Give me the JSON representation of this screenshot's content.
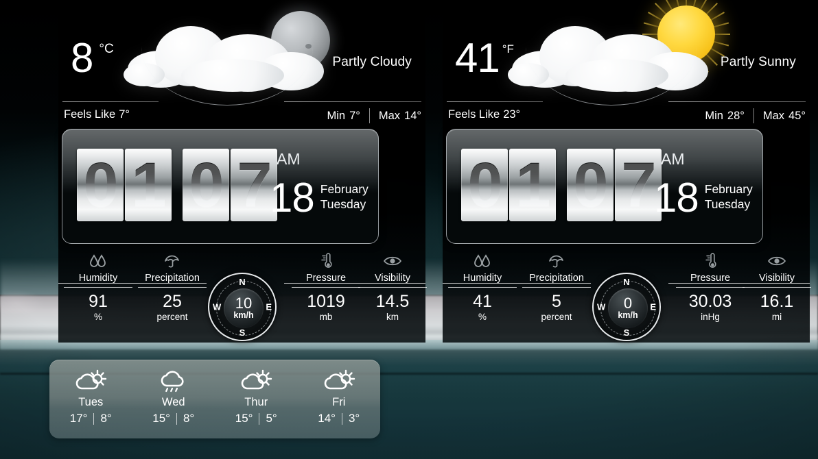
{
  "panels": [
    {
      "id": "left",
      "temperature": "8",
      "unit": "°C",
      "condition": "Partly Cloudy",
      "icon": "moon-cloud-icon",
      "feels_like_label": "Feels Like",
      "feels_like_value": "7°",
      "min_label": "Min",
      "min_value": "7°",
      "max_label": "Max",
      "max_value": "14°",
      "clock": {
        "hour_digits": [
          "0",
          "1"
        ],
        "minute_digits": [
          "0",
          "7"
        ],
        "meridiem": "AM",
        "day_number": "18",
        "month": "February",
        "weekday": "Tuesday"
      },
      "stats": {
        "humidity": {
          "label": "Humidity",
          "value": "91",
          "unit": "%",
          "icon": "droplets-icon"
        },
        "precipitation": {
          "label": "Precipitation",
          "value": "25",
          "unit": "percent",
          "icon": "umbrella-icon"
        },
        "pressure": {
          "label": "Pressure",
          "value": "1019",
          "unit": "mb",
          "icon": "thermometer-icon"
        },
        "visibility": {
          "label": "Visibility",
          "value": "14.5",
          "unit": "km",
          "icon": "eye-icon"
        }
      },
      "wind": {
        "value": "10",
        "unit": "km/h",
        "north": "N",
        "east": "E",
        "south": "S",
        "west": "W"
      }
    },
    {
      "id": "right",
      "temperature": "41",
      "unit": "°F",
      "condition": "Partly Sunny",
      "icon": "sun-cloud-icon",
      "feels_like_label": "Feels Like",
      "feels_like_value": "23°",
      "min_label": "Min",
      "min_value": "28°",
      "max_label": "Max",
      "max_value": "45°",
      "clock": {
        "hour_digits": [
          "0",
          "1"
        ],
        "minute_digits": [
          "0",
          "7"
        ],
        "meridiem": "AM",
        "day_number": "18",
        "month": "February",
        "weekday": "Tuesday"
      },
      "stats": {
        "humidity": {
          "label": "Humidity",
          "value": "41",
          "unit": "%",
          "icon": "droplets-icon"
        },
        "precipitation": {
          "label": "Precipitation",
          "value": "5",
          "unit": "percent",
          "icon": "umbrella-icon"
        },
        "pressure": {
          "label": "Pressure",
          "value": "30.03",
          "unit": "inHg",
          "icon": "thermometer-icon"
        },
        "visibility": {
          "label": "Visibility",
          "value": "16.1",
          "unit": "mi",
          "icon": "eye-icon"
        }
      },
      "wind": {
        "value": "0",
        "unit": "km/h",
        "north": "N",
        "east": "E",
        "south": "S",
        "west": "W"
      }
    }
  ],
  "forecast": {
    "days": [
      {
        "name": "Tues",
        "high": "17°",
        "low": "8°",
        "icon": "sun-cloud-icon"
      },
      {
        "name": "Wed",
        "high": "15°",
        "low": "8°",
        "icon": "rain-cloud-icon"
      },
      {
        "name": "Thur",
        "high": "15°",
        "low": "5°",
        "icon": "sun-cloud-icon"
      },
      {
        "name": "Fri",
        "high": "14°",
        "low": "3°",
        "icon": "sun-cloud-icon"
      }
    ]
  },
  "colors": {
    "panel_background": "#000000",
    "text": "#ffffff",
    "sun": "#ffd83e",
    "moon": "#b7bbbe",
    "water": "#17383d",
    "forecast_panel": "#8d9794"
  }
}
